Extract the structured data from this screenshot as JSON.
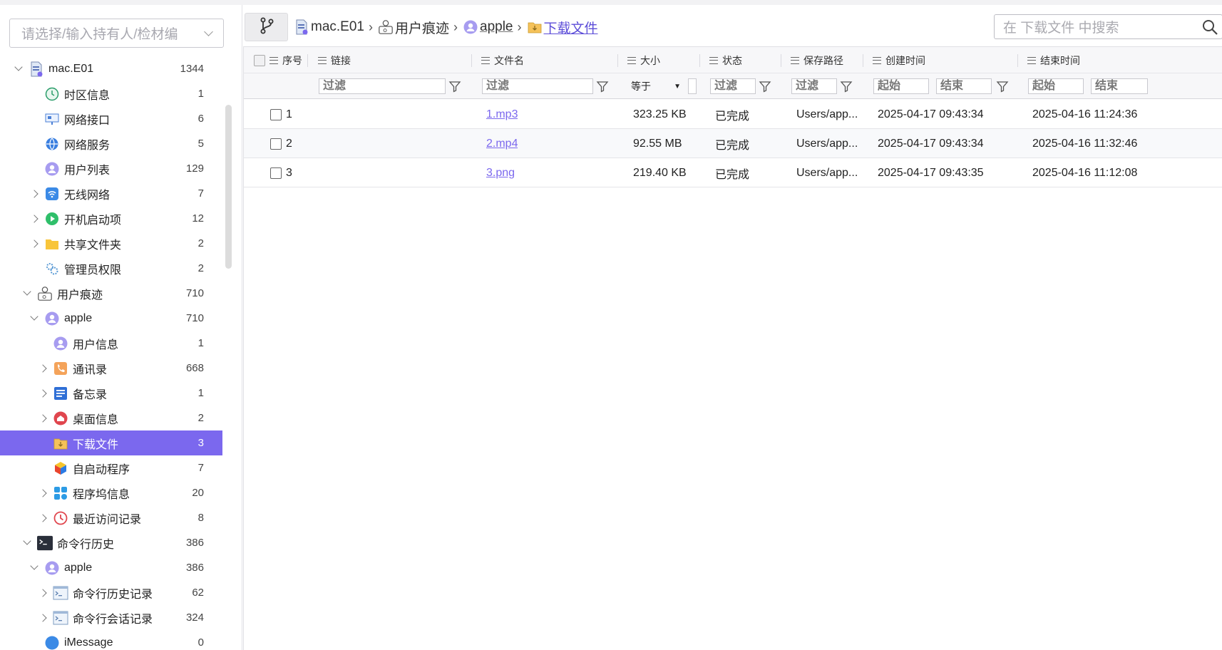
{
  "sidebar": {
    "owner_placeholder": "请选择/输入持有人/检材编",
    "tree": [
      {
        "label": "mac.E01",
        "count": "1344",
        "icon": "disk-image-icon",
        "toggle": "down",
        "indent": 18
      },
      {
        "label": "时区信息",
        "count": "1",
        "icon": "clock-icon",
        "toggle": "none",
        "indent": 40
      },
      {
        "label": "网络接口",
        "count": "6",
        "icon": "network-interface-icon",
        "toggle": "none",
        "indent": 40
      },
      {
        "label": "网络服务",
        "count": "5",
        "icon": "globe-icon",
        "toggle": "none",
        "indent": 40
      },
      {
        "label": "用户列表",
        "count": "129",
        "icon": "user-icon",
        "toggle": "none",
        "indent": 40
      },
      {
        "label": "无线网络",
        "count": "7",
        "icon": "wifi-icon",
        "toggle": "right",
        "indent": 40
      },
      {
        "label": "开机启动项",
        "count": "12",
        "icon": "play-icon",
        "toggle": "right",
        "indent": 40
      },
      {
        "label": "共享文件夹",
        "count": "2",
        "icon": "folder-icon",
        "toggle": "right",
        "indent": 40
      },
      {
        "label": "管理员权限",
        "count": "2",
        "icon": "admin-gear-icon",
        "toggle": "none",
        "indent": 40
      },
      {
        "label": "用户痕迹",
        "count": "710",
        "icon": "user-trace-icon",
        "toggle": "down",
        "indent": 30
      },
      {
        "label": "apple",
        "count": "710",
        "icon": "user-icon",
        "toggle": "down",
        "indent": 40
      },
      {
        "label": "用户信息",
        "count": "1",
        "icon": "user-icon",
        "toggle": "none",
        "indent": 52
      },
      {
        "label": "通讯录",
        "count": "668",
        "icon": "contacts-icon",
        "toggle": "right",
        "indent": 52
      },
      {
        "label": "备忘录",
        "count": "1",
        "icon": "notes-icon",
        "toggle": "right",
        "indent": 52
      },
      {
        "label": "桌面信息",
        "count": "2",
        "icon": "desktop-home-icon",
        "toggle": "right",
        "indent": 52
      },
      {
        "label": "下载文件",
        "count": "3",
        "icon": "download-folder-icon",
        "toggle": "none",
        "indent": 52,
        "selected": true
      },
      {
        "label": "自启动程序",
        "count": "7",
        "icon": "cube-icon",
        "toggle": "none",
        "indent": 52
      },
      {
        "label": "程序坞信息",
        "count": "20",
        "icon": "dock-apps-icon",
        "toggle": "right",
        "indent": 52
      },
      {
        "label": "最近访问记录",
        "count": "8",
        "icon": "recent-history-icon",
        "toggle": "right",
        "indent": 52
      },
      {
        "label": "命令行历史",
        "count": "386",
        "icon": "terminal-icon",
        "toggle": "down",
        "indent": 30
      },
      {
        "label": "apple",
        "count": "386",
        "icon": "user-icon",
        "toggle": "down",
        "indent": 40
      },
      {
        "label": "命令行历史记录",
        "count": "62",
        "icon": "terminal-window-icon",
        "toggle": "right",
        "indent": 52
      },
      {
        "label": "命令行会话记录",
        "count": "324",
        "icon": "terminal-window-icon",
        "toggle": "right",
        "indent": 52
      },
      {
        "label": "iMessage",
        "count": "0",
        "icon": "message-icon",
        "toggle": "none",
        "indent": 40
      }
    ]
  },
  "breadcrumb": [
    {
      "label": "mac.E01",
      "icon": "disk-image-icon",
      "style": "plain"
    },
    {
      "label": "用户痕迹",
      "icon": "user-trace-icon",
      "style": "plain"
    },
    {
      "label": "apple",
      "icon": "user-icon",
      "style": "underline"
    },
    {
      "label": "下载文件",
      "icon": "download-folder-icon",
      "style": "active"
    }
  ],
  "search": {
    "placeholder": "在 下载文件 中搜索"
  },
  "table": {
    "columns": [
      {
        "key": "seq",
        "label": "序号"
      },
      {
        "key": "link",
        "label": "链接"
      },
      {
        "key": "filename",
        "label": "文件名"
      },
      {
        "key": "size",
        "label": "大小"
      },
      {
        "key": "status",
        "label": "状态"
      },
      {
        "key": "path",
        "label": "保存路径"
      },
      {
        "key": "created",
        "label": "创建时间"
      },
      {
        "key": "end",
        "label": "结束时间"
      }
    ],
    "filter": {
      "filter_text": "过滤",
      "size_operator": "等于",
      "range_start": "起始",
      "range_end": "结束"
    },
    "rows": [
      {
        "seq": "1",
        "link": "",
        "filename": "1.mp3",
        "size": "323.25 KB",
        "status": "已完成",
        "path": "Users/app...",
        "created": "2025-04-17 09:43:34",
        "end": "2025-04-16 11:24:36"
      },
      {
        "seq": "2",
        "link": "",
        "filename": "2.mp4",
        "size": "92.55 MB",
        "status": "已完成",
        "path": "Users/app...",
        "created": "2025-04-17 09:43:34",
        "end": "2025-04-16 11:32:46"
      },
      {
        "seq": "3",
        "link": "",
        "filename": "3.png",
        "size": "219.40 KB",
        "status": "已完成",
        "path": "Users/app...",
        "created": "2025-04-17 09:43:35",
        "end": "2025-04-16 11:12:08"
      }
    ]
  },
  "colors": {
    "accent": "#7b68ee",
    "selected_bg": "#7b68ee",
    "link": "#7b68ee"
  }
}
